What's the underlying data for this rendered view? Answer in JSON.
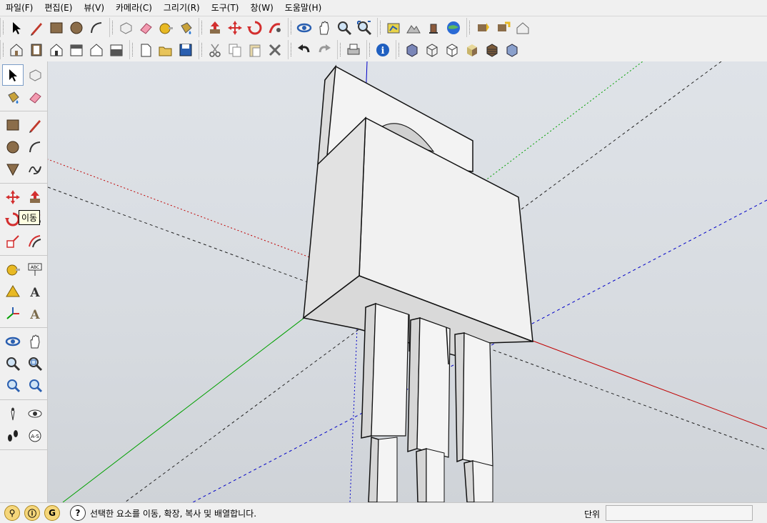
{
  "menu": [
    "파일(F)",
    "편집(E)",
    "뷰(V)",
    "카메라(C)",
    "그리기(R)",
    "도구(T)",
    "창(W)",
    "도움말(H)"
  ],
  "toolbar_row1": [
    [
      "select-icon",
      "pencil-icon",
      "rectangle-icon",
      "circle-icon",
      "arc-icon"
    ],
    [
      "make-component-icon",
      "eraser-icon",
      "tape-measure-icon",
      "paint-bucket-icon"
    ],
    [
      "push-pull-icon",
      "move-icon",
      "rotate-icon",
      "follow-me-icon"
    ],
    [
      "orbit-icon",
      "pan-icon",
      "zoom-icon",
      "zoom-extents-icon"
    ],
    [
      "add-location-icon",
      "terrain-icon",
      "get-models-icon",
      "google-earth-icon"
    ],
    [
      "get-components-icon",
      "share-component-icon",
      "share-model-icon"
    ]
  ],
  "toolbar_row2": [
    [
      "iso-view-icon",
      "top-view-icon",
      "front-view-icon",
      "right-view-icon",
      "back-view-icon",
      "left-view-icon"
    ],
    [
      "new-file-icon",
      "open-folder-icon",
      "save-icon"
    ],
    [
      "cut-icon",
      "copy-icon",
      "paste-icon",
      "delete-icon"
    ],
    [
      "undo-icon",
      "redo-icon"
    ],
    [
      "print-icon"
    ],
    [
      "model-info-icon"
    ],
    [
      "xray-icon",
      "wireframe-icon",
      "hidden-line-icon",
      "shaded-icon",
      "shaded-texture-icon",
      "monochrome-icon"
    ]
  ],
  "left_toolbar": [
    [
      "select-icon",
      "make-component-icon",
      "paint-bucket-icon",
      "eraser-icon"
    ],
    [
      "rectangle-icon",
      "line-icon",
      "circle-icon",
      "arc-icon",
      "polygon-icon",
      "freehand-icon"
    ],
    [
      "move-icon",
      "push-pull-icon",
      "rotate-icon",
      "follow-me-icon",
      "scale-icon",
      "offset-icon"
    ],
    [
      "tape-measure-icon",
      "dimension-icon",
      "protractor-icon",
      "text-icon",
      "axes-icon",
      "3d-text-icon"
    ],
    [
      "orbit-icon",
      "pan-icon",
      "zoom-icon",
      "zoom-window-icon",
      "previous-view-icon",
      "next-view-icon"
    ],
    [
      "position-camera-icon",
      "look-around-icon",
      "walk-icon",
      "section-plane-icon"
    ]
  ],
  "tooltip": "이동",
  "status": {
    "message": "선택한 요소를 이동, 확장, 복사 및 배열합니다.",
    "units_label": "단위",
    "units_value": ""
  },
  "colors": {
    "red_axis": "#c00000",
    "green_axis": "#00a000",
    "blue_axis": "#0000c8",
    "background": "#d9dde2"
  }
}
